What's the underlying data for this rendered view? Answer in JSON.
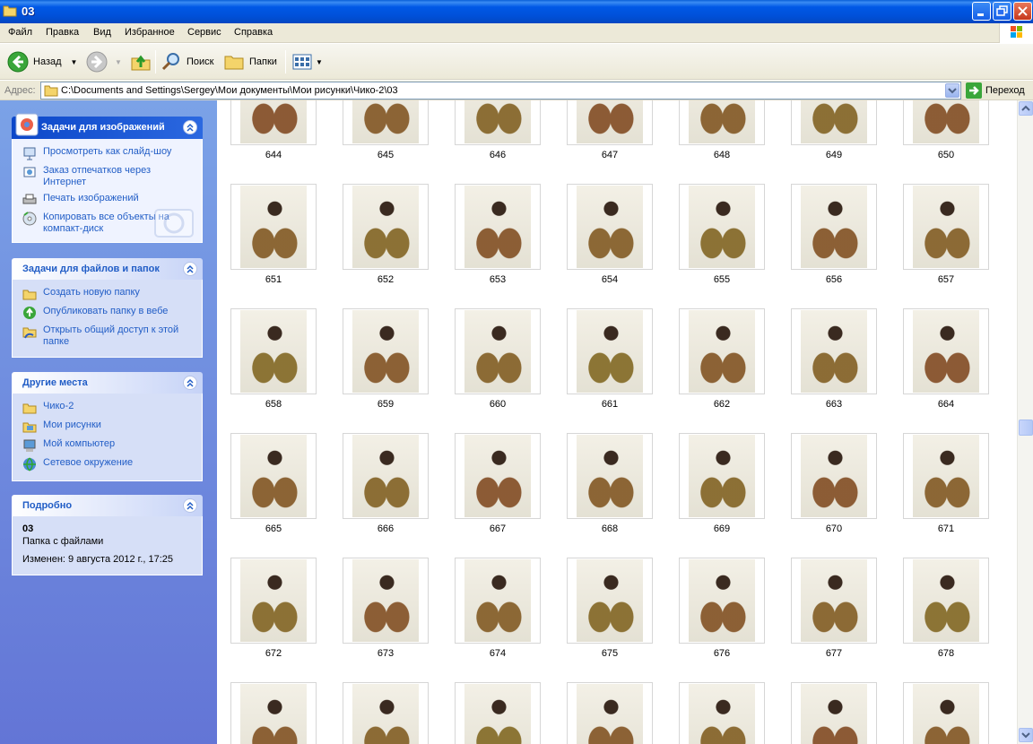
{
  "window": {
    "title": "03"
  },
  "menu": [
    "Файл",
    "Правка",
    "Вид",
    "Избранное",
    "Сервис",
    "Справка"
  ],
  "toolbar": {
    "back": "Назад",
    "search": "Поиск",
    "folders": "Папки"
  },
  "address": {
    "label": "Адрес:",
    "path": "C:\\Documents and Settings\\Sergey\\Мои документы\\Мои рисунки\\Чико-2\\03",
    "go": "Переход"
  },
  "panels": {
    "image_tasks": {
      "title": "Задачи для изображений",
      "items": [
        "Просмотреть как слайд-шоу",
        "Заказ отпечатков через Интернет",
        "Печать изображений",
        "Копировать все объекты на компакт-диск"
      ]
    },
    "file_tasks": {
      "title": "Задачи для файлов и папок",
      "items": [
        "Создать новую папку",
        "Опубликовать папку в вебе",
        "Открыть общий доступ к этой папке"
      ]
    },
    "other_places": {
      "title": "Другие места",
      "items": [
        "Чико-2",
        "Мои рисунки",
        "Мой компьютер",
        "Сетевое окружение"
      ]
    },
    "details": {
      "title": "Подробно",
      "name": "03",
      "type": "Папка с файлами",
      "modified": "Изменен: 9 августа 2012 г., 17:25"
    }
  },
  "thumbnails": [
    "644",
    "645",
    "646",
    "647",
    "648",
    "649",
    "650",
    "651",
    "652",
    "653",
    "654",
    "655",
    "656",
    "657",
    "658",
    "659",
    "660",
    "661",
    "662",
    "663",
    "664",
    "665",
    "666",
    "667",
    "668",
    "669",
    "670",
    "671",
    "672",
    "673",
    "674",
    "675",
    "676",
    "677",
    "678",
    "",
    "",
    "",
    "",
    "",
    "",
    ""
  ],
  "colors": {
    "title_bar": "#0058e6",
    "task_link": "#215dc6",
    "pane_bg": "#7ba2e7"
  }
}
